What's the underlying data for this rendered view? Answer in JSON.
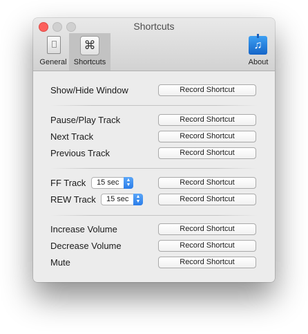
{
  "window": {
    "title": "Shortcuts"
  },
  "toolbar": {
    "items": [
      {
        "label": "General",
        "icon": "general-switch-icon",
        "selected": false
      },
      {
        "label": "Shortcuts",
        "icon": "command-key-icon",
        "symbol": "⌘",
        "selected": true
      },
      {
        "label": "About",
        "icon": "music-note-icon",
        "symbol": "♫",
        "selected": false
      }
    ]
  },
  "shortcuts": {
    "show_hide": {
      "label": "Show/Hide Window",
      "button": "Record Shortcut"
    },
    "pause_play": {
      "label": "Pause/Play Track",
      "button": "Record Shortcut"
    },
    "next": {
      "label": "Next Track",
      "button": "Record Shortcut"
    },
    "previous": {
      "label": "Previous Track",
      "button": "Record Shortcut"
    },
    "ff": {
      "label": "FF Track",
      "interval": "15 sec",
      "button": "Record Shortcut"
    },
    "rew": {
      "label": "REW Track",
      "interval": "15 sec",
      "button": "Record Shortcut"
    },
    "vol_up": {
      "label": "Increase Volume",
      "button": "Record Shortcut"
    },
    "vol_down": {
      "label": "Decrease Volume",
      "button": "Record Shortcut"
    },
    "mute": {
      "label": "Mute",
      "button": "Record Shortcut"
    }
  },
  "stepper_glyphs": {
    "up": "▲",
    "down": "▼"
  },
  "colors": {
    "close": "#fc605c",
    "accent": "#2b7de9",
    "toolbar_selected": "#c2c2c2"
  }
}
